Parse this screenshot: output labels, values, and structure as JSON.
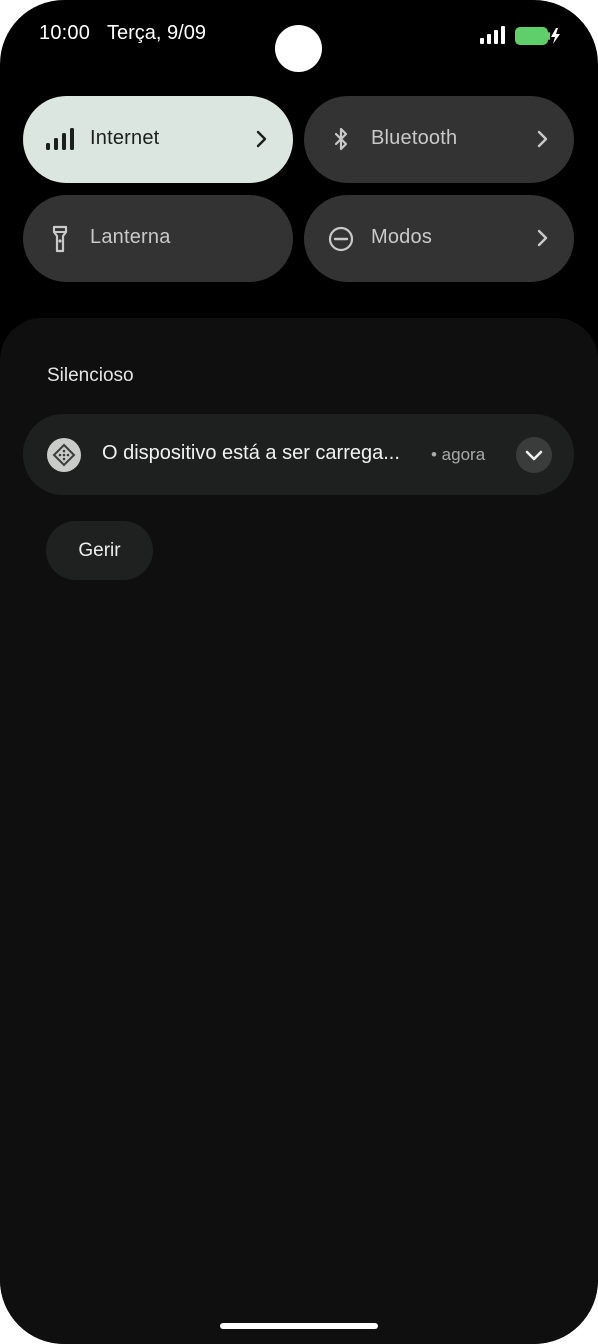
{
  "status_bar": {
    "time": "10:00",
    "date": "Terça, 9/09",
    "battery_color": "#5fcf6a",
    "icons": [
      "cell-signal-icon",
      "battery-charging-icon"
    ]
  },
  "quick_settings": {
    "tiles": [
      {
        "label": "Internet",
        "icon": "signal-bars-icon",
        "active": true,
        "has_chevron": true
      },
      {
        "label": "Bluetooth",
        "icon": "bluetooth-icon",
        "active": false,
        "has_chevron": true
      },
      {
        "label": "Lanterna",
        "icon": "flashlight-icon",
        "active": false,
        "has_chevron": false
      },
      {
        "label": "Modos",
        "icon": "do-not-disturb-icon",
        "active": false,
        "has_chevron": true
      }
    ],
    "active_color": "#dce6e0",
    "inactive_color": "#333333"
  },
  "notifications": {
    "section_title": "Silencioso",
    "items": [
      {
        "app_icon": "charging-app-icon",
        "title": "O dispositivo está a ser carrega...",
        "time": "• agora",
        "expand_icon": "chevron-down-icon"
      }
    ],
    "manage_label": "Gerir"
  }
}
